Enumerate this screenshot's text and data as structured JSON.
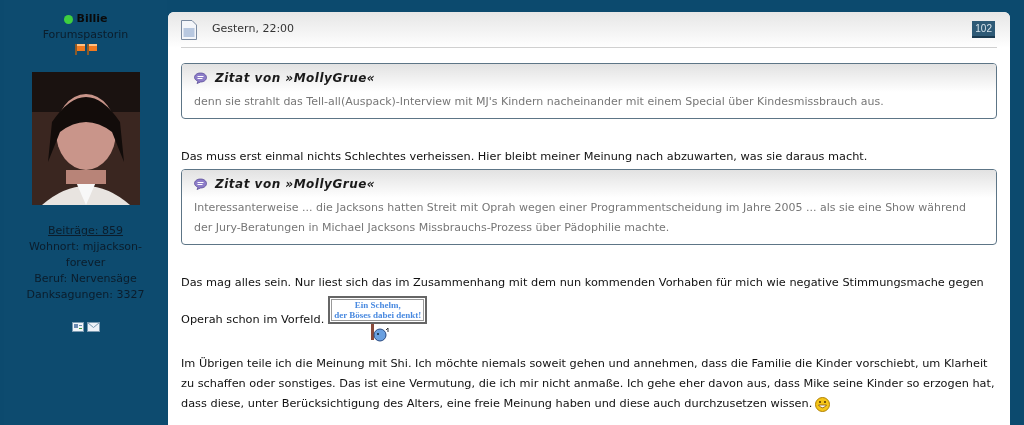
{
  "sidebar": {
    "user": {
      "name": "Billie",
      "online": true,
      "rank": "Forumspastorin"
    },
    "stats": [
      {
        "kind": "link",
        "text": "Beiträge: 859"
      },
      {
        "kind": "text",
        "text": "Wohnort: mjjackson-forever"
      },
      {
        "kind": "text",
        "text": "Beruf: Nervensäge"
      },
      {
        "kind": "text",
        "text": "Danksagungen: 3327"
      }
    ]
  },
  "post": {
    "date": "Gestern, 22:00",
    "number": "102",
    "content": [
      {
        "kind": "quote",
        "title": "Zitat von »MollyGrue«",
        "text": "denn sie strahlt das Tell-all(Auspack)-Interview mit MJ's Kindern nacheinander mit einem Special über Kindesmissbrauch aus."
      },
      {
        "kind": "paragraph",
        "text": "Das muss erst einmal nichts Schlechtes verheissen. Hier bleibt meiner Meinung nach abzuwarten, was sie daraus macht."
      },
      {
        "kind": "quote",
        "title": "Zitat von »MollyGrue«",
        "text": "Interessanterweise ... die Jacksons hatten Streit mit Oprah wegen einer Programmentscheidung im Jahre 2005 ... als sie eine Show während der Jury-Beratungen in Michael Jacksons Missbrauchs-Prozess über Pädophilie machte."
      },
      {
        "kind": "paragraph",
        "lines": [
          "Das mag alles sein. Nur liest sich das im Zusammenhang mit dem nun kommenden Vorhaben für mich wie negative Stimmungsmache gegen",
          "Operah schon im Vorfeld."
        ],
        "sign": [
          "Ein Schelm,",
          "der Böses dabei denkt!"
        ]
      },
      {
        "kind": "paragraph",
        "text": "Im Übrigen teile ich die Meinung mit Shi. Ich möchte niemals soweit gehen und annehmen, dass die Familie die Kinder vorschiebt, um Klarheit zu schaffen oder sonstiges. Das ist eine Vermutung, die ich mir nicht anmaße. Ich gehe eher davon aus, dass Mike seine Kinder so erzogen hat, dass diese, unter Berücksichtigung des Alters, eine freie Meinung haben und diese auch durchzusetzen wissen.",
        "smiley": true
      }
    ]
  }
}
